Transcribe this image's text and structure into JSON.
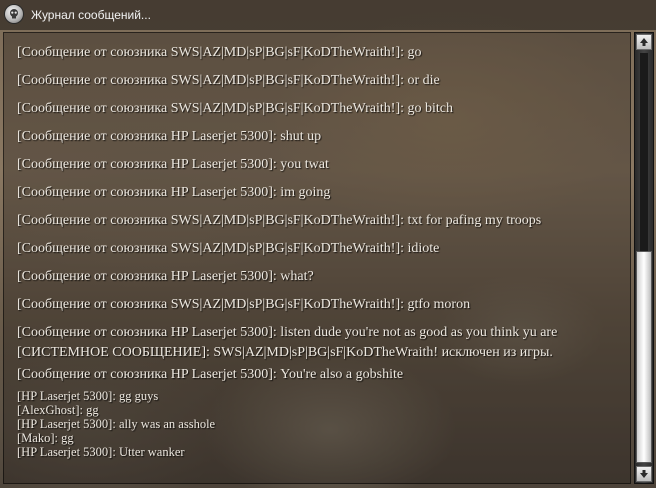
{
  "window": {
    "title": "Журнал сообщений..."
  },
  "icons": {
    "title": "skull-icon",
    "scroll_up": "arrow-up-icon",
    "scroll_down": "arrow-down-icon"
  },
  "scrollbar": {
    "thumb_position_fraction": 0.53
  },
  "messages": [
    "[Сообщение от союзника SWS|AZ|MD|sP|BG|sF|KoDTheWraith!]: go",
    "[Сообщение от союзника SWS|AZ|MD|sP|BG|sF|KoDTheWraith!]: or die",
    "[Сообщение от союзника SWS|AZ|MD|sP|BG|sF|KoDTheWraith!]: go bitch",
    "[Сообщение от союзника HP Laserjet 5300]: shut up",
    "[Сообщение от союзника HP Laserjet 5300]: you twat",
    "[Сообщение от союзника HP Laserjet 5300]: im going",
    "[Сообщение от союзника SWS|AZ|MD|sP|BG|sF|KoDTheWraith!]: txt for pafing my troops",
    "[Сообщение от союзника SWS|AZ|MD|sP|BG|sF|KoDTheWraith!]: idiote",
    "[Сообщение от союзника HP Laserjet 5300]: what?",
    "[Сообщение от союзника SWS|AZ|MD|sP|BG|sF|KoDTheWraith!]: gtfo moron",
    "[Сообщение от союзника HP Laserjet 5300]: listen dude you're not as good as you think yu are",
    "[СИСТЕМНОЕ СООБЩЕНИЕ]: SWS|AZ|MD|sP|BG|sF|KoDTheWraith! исключен из игры.",
    "[Сообщение от союзника HP Laserjet 5300]: You're also a gobshite"
  ],
  "chat": [
    "[HP Laserjet 5300]: gg guys",
    "[AlexGhost]: gg",
    "[HP Laserjet 5300]: ally was an asshole",
    "[Mako]: gg",
    "[HP Laserjet 5300]: Utter wanker"
  ]
}
